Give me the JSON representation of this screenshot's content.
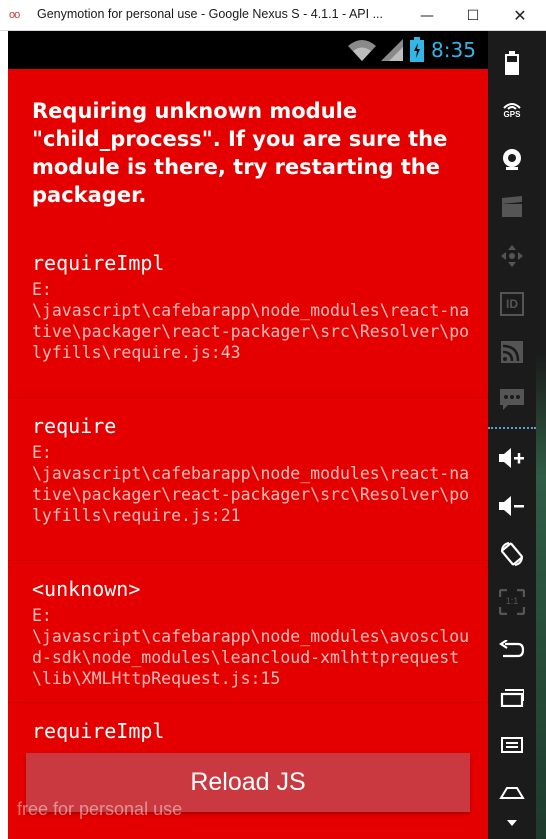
{
  "window": {
    "title": "Genymotion for personal use - Google Nexus S - 4.1.1 - API ...",
    "icon_label": "oo",
    "minimize": "—",
    "maximize": "☐",
    "close": "✕"
  },
  "statusbar": {
    "time": "8:35",
    "time_color": "#33b5e5"
  },
  "error": {
    "title": "Requiring unknown module \"child_process\". If you are sure the module is there, try restarting the packager.",
    "background": "#e50000",
    "frames": [
      {
        "name": "requireImpl",
        "file": "E:\n\\javascript\\cafebarapp\\node_modules\\react-native\\packager\\react-packager\\src\\Resolver\\polyfills\\require.js:43"
      },
      {
        "name": "require",
        "file": "E:\n\\javascript\\cafebarapp\\node_modules\\react-native\\packager\\react-packager\\src\\Resolver\\polyfills\\require.js:21"
      },
      {
        "name": "<unknown>",
        "file": "E:\n\\javascript\\cafebarapp\\node_modules\\avoscloud-sdk\\node_modules\\leancloud-xmlhttprequest\\lib\\XMLHttpRequest.js:15"
      },
      {
        "name": "requireImpl",
        "file": ""
      }
    ],
    "reload_label": "Reload JS"
  },
  "watermark": "free for personal use",
  "panel": {
    "icons": [
      "battery-icon",
      "gps-icon",
      "webcam-icon",
      "video-capture-icon",
      "dpad-icon",
      "device-id-icon",
      "cast-icon",
      "sms-icon",
      "volume-up-icon",
      "volume-down-icon",
      "rotate-icon",
      "scale-icon",
      "back-icon",
      "recent-apps-icon",
      "menu-icon",
      "home-icon"
    ],
    "gps_label": "GPS",
    "id_label": "ID",
    "scale_label": "1:1"
  }
}
